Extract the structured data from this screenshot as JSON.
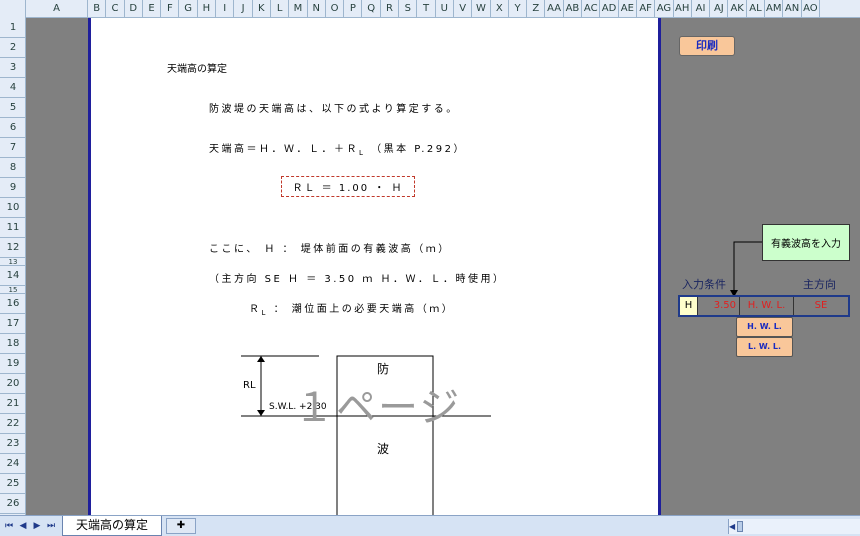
{
  "columns": [
    "A",
    "B",
    "C",
    "D",
    "E",
    "F",
    "G",
    "H",
    "I",
    "J",
    "K",
    "L",
    "M",
    "N",
    "O",
    "P",
    "Q",
    "R",
    "S",
    "T",
    "U",
    "V",
    "W",
    "X",
    "Y",
    "Z",
    "AA",
    "AB",
    "AC",
    "AD",
    "AE",
    "AF",
    "AG",
    "AH",
    "AI",
    "AJ",
    "AK",
    "AL",
    "AM",
    "AN",
    "AO"
  ],
  "rows": [
    "1",
    "2",
    "3",
    "4",
    "5",
    "6",
    "7",
    "8",
    "9",
    "10",
    "11",
    "12",
    "13",
    "14",
    "15",
    "16",
    "17",
    "18",
    "19",
    "20",
    "21",
    "22",
    "23",
    "24",
    "25",
    "26"
  ],
  "page": {
    "title": "天端高の算定",
    "line1": "防波堤の天端高は、以下の式より算定する。",
    "formula_main": "天端高＝Ｈ．Ｗ．Ｌ．＋Ｒ",
    "formula_sub": "L",
    "formula_ref": "（黒本 P.292）",
    "formula_box_text": "ＲＬ ＝ 1.00 ・ Ｈ",
    "def1": "ここに、 Ｈ ： 堤体前面の有義波高（ｍ）",
    "def2": "（主方向 SE Ｈ ＝ 3.50 ｍ Ｈ．Ｗ．Ｌ．時使用）",
    "def3_prefix": "Ｒ",
    "def3_sub": "L",
    "def3_rest": "： 潮位面上の必要天端高（ｍ）",
    "diagram_rl": "RL",
    "diagram_swl": "S.W.L. +2.30",
    "diagram_box_top": "防",
    "diagram_box_bottom": "波",
    "watermark": "１ページ"
  },
  "side": {
    "print_button": "印刷",
    "note": "有義波高を入力",
    "input_label": "入力条件",
    "direction_label": "主方向",
    "input": {
      "h_label": "H",
      "h_value": "3.50",
      "tide": "H. W. L.",
      "direction": "SE"
    },
    "options": [
      "H. W. L.",
      "L. W. L."
    ]
  },
  "tabs": {
    "sheet_name": "天端高の算定"
  },
  "colors": {
    "page_border": "#1f1f9c",
    "button_fill": "#f9c79a",
    "note_fill": "#ccffcc",
    "value_red": "#e02020"
  }
}
